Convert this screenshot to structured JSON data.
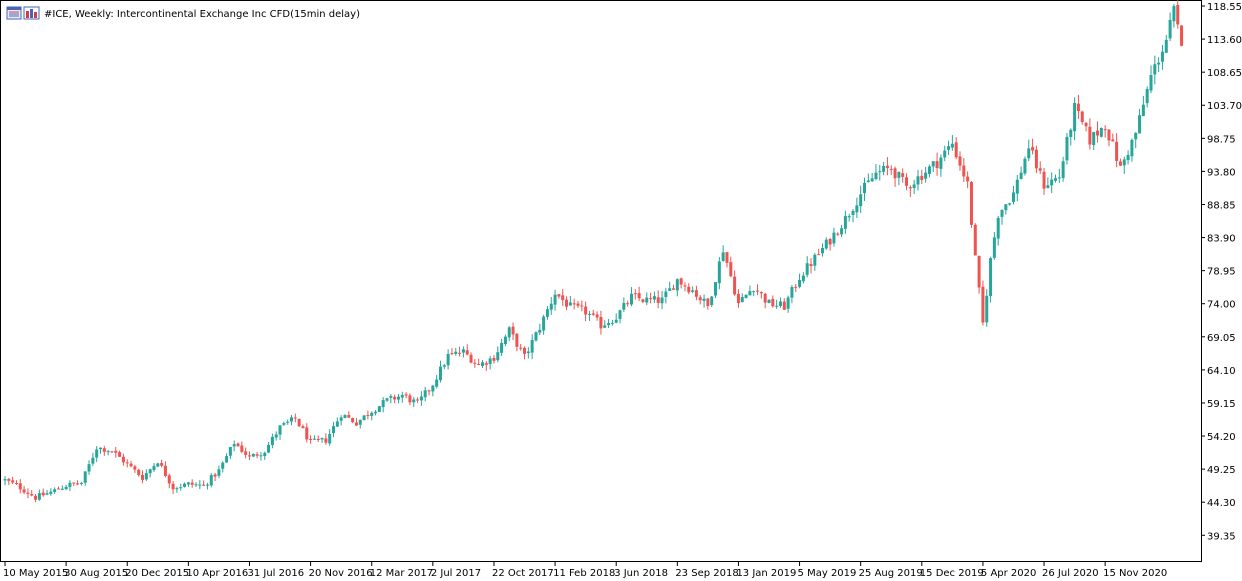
{
  "header": {
    "title": "#ICE, Weekly:  Intercontinental Exchange Inc CFD(15min delay)",
    "icons": [
      "window-restore-icon",
      "bar-chart-icon"
    ]
  },
  "colors": {
    "bull": "#26a69a",
    "bear": "#ef5350",
    "background": "#ffffff",
    "axis": "#000000"
  },
  "chart_data": {
    "type": "candlestick",
    "symbol": "#ICE",
    "timeframe": "Weekly",
    "title": "#ICE, Weekly:  Intercontinental Exchange Inc CFD(15min delay)",
    "ylim": [
      35.5,
      119.3
    ],
    "grid": false,
    "y_ticks": [
      "118.55",
      "113.60",
      "108.65",
      "103.70",
      "98.75",
      "93.80",
      "88.85",
      "83.90",
      "78.95",
      "74.00",
      "69.05",
      "64.10",
      "59.15",
      "54.20",
      "49.25",
      "44.30",
      "39.35"
    ],
    "x_ticks": [
      "10 May 2015",
      "30 Aug 2015",
      "20 Dec 2015",
      "10 Apr 2016",
      "31 Jul 2016",
      "20 Nov 2016",
      "12 Mar 2017",
      "2 Jul 2017",
      "22 Oct 2017",
      "11 Feb 2018",
      "3 Jun 2018",
      "23 Sep 2018",
      "13 Jan 2019",
      "5 May 2019",
      "25 Aug 2019",
      "15 Dec 2019",
      "5 Apr 2020",
      "26 Jul 2020",
      "15 Nov 2020"
    ],
    "weeks_per_tick": 16,
    "close_path": [
      [
        0,
        47.6
      ],
      [
        4,
        46.5
      ],
      [
        8,
        45.0
      ],
      [
        12,
        45.8
      ],
      [
        16,
        46.8
      ],
      [
        20,
        47.2
      ],
      [
        24,
        52.5
      ],
      [
        28,
        52.0
      ],
      [
        32,
        50.0
      ],
      [
        36,
        48.0
      ],
      [
        40,
        50.5
      ],
      [
        44,
        46.5
      ],
      [
        48,
        47.0
      ],
      [
        52,
        46.8
      ],
      [
        56,
        49.0
      ],
      [
        60,
        53.2
      ],
      [
        64,
        51.0
      ],
      [
        68,
        52.0
      ],
      [
        72,
        55.5
      ],
      [
        76,
        56.8
      ],
      [
        80,
        53.2
      ],
      [
        84,
        53.6
      ],
      [
        88,
        57.5
      ],
      [
        92,
        56.2
      ],
      [
        96,
        58.0
      ],
      [
        100,
        59.5
      ],
      [
        104,
        60.3
      ],
      [
        108,
        59.0
      ],
      [
        112,
        62.0
      ],
      [
        116,
        66.2
      ],
      [
        120,
        66.8
      ],
      [
        124,
        64.8
      ],
      [
        128,
        66.0
      ],
      [
        132,
        70.0
      ],
      [
        136,
        66.0
      ],
      [
        140,
        70.5
      ],
      [
        144,
        75.6
      ],
      [
        148,
        73.5
      ],
      [
        152,
        72.8
      ],
      [
        156,
        70.8
      ],
      [
        160,
        72.0
      ],
      [
        164,
        75.0
      ],
      [
        168,
        74.5
      ],
      [
        172,
        74.5
      ],
      [
        176,
        77.6
      ],
      [
        180,
        76.0
      ],
      [
        184,
        73.6
      ],
      [
        188,
        82.2
      ],
      [
        192,
        74.0
      ],
      [
        196,
        76.6
      ],
      [
        200,
        74.0
      ],
      [
        204,
        73.6
      ],
      [
        208,
        78.0
      ],
      [
        212,
        80.8
      ],
      [
        216,
        83.6
      ],
      [
        220,
        86.7
      ],
      [
        224,
        90.5
      ],
      [
        228,
        93.5
      ],
      [
        232,
        94.3
      ],
      [
        236,
        91.5
      ],
      [
        240,
        93.3
      ],
      [
        244,
        95.2
      ],
      [
        248,
        98.0
      ],
      [
        252,
        91.8
      ],
      [
        254,
        80.6
      ],
      [
        256,
        71.0
      ],
      [
        258,
        80.5
      ],
      [
        260,
        87.5
      ],
      [
        264,
        90.5
      ],
      [
        268,
        97.5
      ],
      [
        272,
        91.8
      ],
      [
        276,
        93.0
      ],
      [
        280,
        103.2
      ],
      [
        284,
        98.5
      ],
      [
        288,
        100.8
      ],
      [
        292,
        94.2
      ],
      [
        296,
        99.5
      ],
      [
        300,
        108.0
      ],
      [
        304,
        113.5
      ],
      [
        306,
        117.8
      ],
      [
        308,
        112.0
      ]
    ],
    "range_weeks": [
      0,
      308
    ],
    "approx_last_close": 112.0
  }
}
